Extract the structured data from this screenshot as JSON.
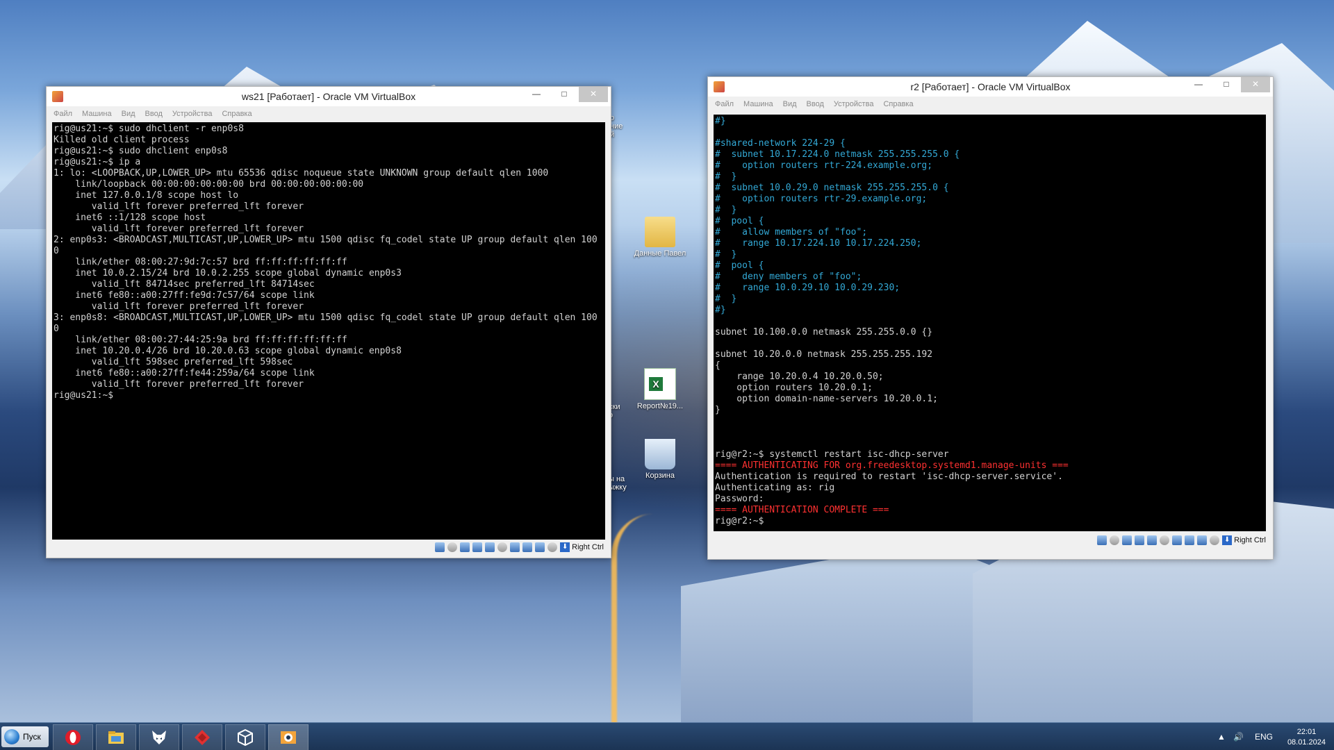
{
  "desktop": {
    "icons": [
      {
        "label": "Данные Павел",
        "type": "folder"
      },
      {
        "label": "Report№19...",
        "type": "excel"
      },
      {
        "label": "Корзина",
        "type": "recycle-bin"
      }
    ],
    "partial_labels": [
      "ые",
      "а",
      "ски",
      "о",
      "ы на",
      "ыжку",
      "о",
      "ние",
      "й"
    ]
  },
  "ws21": {
    "title": "ws21 [Работает] - Oracle VM VirtualBox",
    "menu": [
      "Файл",
      "Машина",
      "Вид",
      "Ввод",
      "Устройства",
      "Справка"
    ],
    "status_key": "Right Ctrl",
    "terminal": [
      "rig@us21:~$ sudo dhclient -r enp0s8",
      "Killed old client process",
      "rig@us21:~$ sudo dhclient enp0s8",
      "rig@us21:~$ ip a",
      "1: lo: <LOOPBACK,UP,LOWER_UP> mtu 65536 qdisc noqueue state UNKNOWN group default qlen 1000",
      "    link/loopback 00:00:00:00:00:00 brd 00:00:00:00:00:00",
      "    inet 127.0.0.1/8 scope host lo",
      "       valid_lft forever preferred_lft forever",
      "    inet6 ::1/128 scope host",
      "       valid_lft forever preferred_lft forever",
      "2: enp0s3: <BROADCAST,MULTICAST,UP,LOWER_UP> mtu 1500 qdisc fq_codel state UP group default qlen 100",
      "0",
      "    link/ether 08:00:27:9d:7c:57 brd ff:ff:ff:ff:ff:ff",
      "    inet 10.0.2.15/24 brd 10.0.2.255 scope global dynamic enp0s3",
      "       valid_lft 84714sec preferred_lft 84714sec",
      "    inet6 fe80::a00:27ff:fe9d:7c57/64 scope link",
      "       valid_lft forever preferred_lft forever",
      "3: enp0s8: <BROADCAST,MULTICAST,UP,LOWER_UP> mtu 1500 qdisc fq_codel state UP group default qlen 100",
      "0",
      "    link/ether 08:00:27:44:25:9a brd ff:ff:ff:ff:ff:ff",
      "    inet 10.20.0.4/26 brd 10.20.0.63 scope global dynamic enp0s8",
      "       valid_lft 598sec preferred_lft 598sec",
      "    inet6 fe80::a00:27ff:fe44:259a/64 scope link",
      "       valid_lft forever preferred_lft forever",
      "rig@us21:~$"
    ]
  },
  "r2": {
    "title": "r2 [Работает] - Oracle VM VirtualBox",
    "menu": [
      "Файл",
      "Машина",
      "Вид",
      "Ввод",
      "Устройства",
      "Справка"
    ],
    "status_key": "Right Ctrl",
    "terminal": [
      {
        "text": "#}",
        "color": "cyan"
      },
      {
        "text": "",
        "color": "default"
      },
      {
        "text": "#shared-network 224-29 {",
        "color": "cyan"
      },
      {
        "text": "#  subnet 10.17.224.0 netmask 255.255.255.0 {",
        "color": "cyan"
      },
      {
        "text": "#    option routers rtr-224.example.org;",
        "color": "cyan"
      },
      {
        "text": "#  }",
        "color": "cyan"
      },
      {
        "text": "#  subnet 10.0.29.0 netmask 255.255.255.0 {",
        "color": "cyan"
      },
      {
        "text": "#    option routers rtr-29.example.org;",
        "color": "cyan"
      },
      {
        "text": "#  }",
        "color": "cyan"
      },
      {
        "text": "#  pool {",
        "color": "cyan"
      },
      {
        "text": "#    allow members of \"foo\";",
        "color": "cyan"
      },
      {
        "text": "#    range 10.17.224.10 10.17.224.250;",
        "color": "cyan"
      },
      {
        "text": "#  }",
        "color": "cyan"
      },
      {
        "text": "#  pool {",
        "color": "cyan"
      },
      {
        "text": "#    deny members of \"foo\";",
        "color": "cyan"
      },
      {
        "text": "#    range 10.0.29.10 10.0.29.230;",
        "color": "cyan"
      },
      {
        "text": "#  }",
        "color": "cyan"
      },
      {
        "text": "#}",
        "color": "cyan"
      },
      {
        "text": "",
        "color": "default"
      },
      {
        "text": "subnet 10.100.0.0 netmask 255.255.0.0 {}",
        "color": "default"
      },
      {
        "text": "",
        "color": "default"
      },
      {
        "text": "subnet 10.20.0.0 netmask 255.255.255.192",
        "color": "default"
      },
      {
        "text": "{",
        "color": "default"
      },
      {
        "text": "    range 10.20.0.4 10.20.0.50;",
        "color": "default"
      },
      {
        "text": "    option routers 10.20.0.1;",
        "color": "default"
      },
      {
        "text": "    option domain-name-servers 10.20.0.1;",
        "color": "default"
      },
      {
        "text": "}",
        "color": "default"
      },
      {
        "text": "",
        "color": "default"
      },
      {
        "text": "",
        "color": "default"
      },
      {
        "text": "",
        "color": "default"
      },
      {
        "text": "rig@r2:~$ systemctl restart isc-dhcp-server",
        "color": "default"
      },
      {
        "text": "==== AUTHENTICATING FOR org.freedesktop.systemd1.manage-units ===",
        "color": "red"
      },
      {
        "text": "Authentication is required to restart 'isc-dhcp-server.service'.",
        "color": "default"
      },
      {
        "text": "Authenticating as: rig",
        "color": "default"
      },
      {
        "text": "Password:",
        "color": "default"
      },
      {
        "text": "==== AUTHENTICATION COMPLETE ===",
        "color": "red"
      },
      {
        "text": "rig@r2:~$",
        "color": "default"
      }
    ]
  },
  "taskbar": {
    "start_label": "Пуск",
    "apps": [
      "opera-icon",
      "file-explorer-icon",
      "app-fox-icon",
      "app-red-diamond-icon",
      "virtualbox-box-icon",
      "virtualbox-vm-icon"
    ],
    "language": "ENG",
    "time": "22:01",
    "date": "08.01.2024"
  },
  "colors": {
    "terminal_bg": "#000000",
    "terminal_fg": "#d2d2d2",
    "comment_cyan": "#33a9d6",
    "auth_red": "#ff3131",
    "taskbar": "#1b3353"
  }
}
